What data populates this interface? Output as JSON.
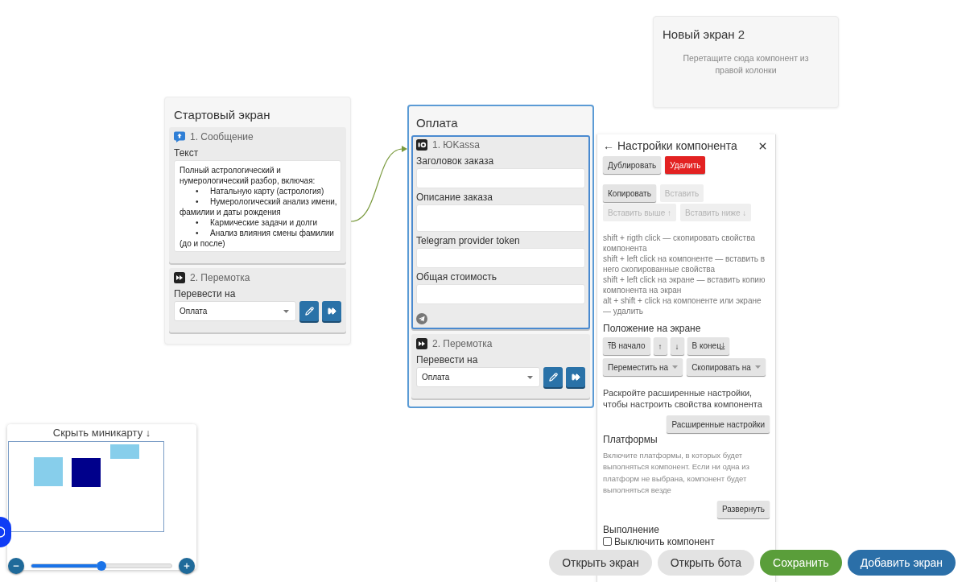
{
  "screens": [
    {
      "title": "Стартовый экран",
      "selected": false,
      "components": [
        {
          "kind": "message",
          "title": "1. Сообщение",
          "selected": false,
          "label": "Текст",
          "intro": "Полный астрологический и нумерологический разбор, включая:",
          "bullets": [
            {
              "marker": "•",
              "text": "Натальную карту (астрология)"
            },
            {
              "marker": "•",
              "text": "Нумерологический анализ имени, фамилии и даты рождения"
            },
            {
              "marker": "•",
              "text": "Кармические задачи и долги"
            },
            {
              "marker": "•",
              "text": "Анализ влияния смены фамилии (до и после)"
            }
          ]
        },
        {
          "kind": "goto",
          "title": "2. Перемотка",
          "selected": false,
          "label": "Перевести на",
          "value": "Оплата"
        }
      ]
    },
    {
      "title": "Оплата",
      "selected": true,
      "components": [
        {
          "kind": "payment",
          "title": "1. ЮKassa",
          "selected": true,
          "fields": [
            {
              "label": "Заголовок заказа",
              "kind": "input"
            },
            {
              "label": "Описание заказа",
              "kind": "textarea"
            },
            {
              "label": "Telegram provider token",
              "kind": "input"
            },
            {
              "label": "Общая стоимость",
              "kind": "input"
            }
          ]
        },
        {
          "kind": "goto",
          "title": "2. Перемотка",
          "selected": false,
          "label": "Перевести на",
          "value": "Оплата"
        }
      ]
    },
    {
      "title": "Новый экран 2",
      "selected": false,
      "hint": "Перетащите сюда компонент из правой колонки"
    }
  ],
  "settings_panel": {
    "title": "← Настройки компонента",
    "actions": [
      {
        "label": "Дублировать",
        "kind": "default",
        "disabled": false
      },
      {
        "label": "Удалить",
        "kind": "danger",
        "disabled": false
      }
    ],
    "clipboard": [
      {
        "label": "Копировать",
        "kind": "default",
        "disabled": false
      },
      {
        "label": "Вставить",
        "kind": "default",
        "disabled": true
      },
      {
        "label": "Вставить выше ↑",
        "kind": "default",
        "disabled": true
      },
      {
        "label": "Вставить ниже ↓",
        "kind": "default",
        "disabled": true
      }
    ],
    "shortcuts": [
      "shift + rigth click — скопировать свойства компонента",
      "shift + left click на компоненте — вставить в него скопированные свойства",
      "shift + left click на экране — вставить копию компонента на экран",
      "alt + shift + click на компоненте или экране — удалить"
    ],
    "position": {
      "title": "Положение на экране",
      "buttons": [
        {
          "label": "⤒В начало",
          "kind": "default",
          "disabled": false
        },
        {
          "label": "↑",
          "kind": "default",
          "disabled": false
        },
        {
          "label": "↓",
          "kind": "default",
          "disabled": false
        },
        {
          "label": "В конец⤓",
          "kind": "default",
          "disabled": false
        }
      ],
      "menus": [
        {
          "label": "Переместить на"
        },
        {
          "label": "Скопировать на"
        }
      ]
    },
    "advanced": {
      "hint": "Раскройте расширенные настройки, чтобы настроить свойства компонента",
      "button": "Расширенные настройки"
    },
    "platforms": {
      "title": "Платформы",
      "description": "Включите платформы, в которых будет выполняться компонент. Если ни одна из платформ не выбрана, компонент будет выполняться везде",
      "button": "Развернуть"
    },
    "execution": {
      "title": "Выполнение",
      "checkbox": {
        "label": "Выключить компонент",
        "checked": false
      }
    }
  },
  "minimap": {
    "title": "Скрыть миникарту ↓"
  },
  "zoom": {
    "level": 0.5
  },
  "bottom_buttons": [
    {
      "label": "Открыть экран",
      "kind": "secondary"
    },
    {
      "label": "Открыть бота",
      "kind": "secondary"
    },
    {
      "label": "Сохранить",
      "kind": "success"
    },
    {
      "label": "Добавить экран",
      "kind": "primary"
    }
  ]
}
